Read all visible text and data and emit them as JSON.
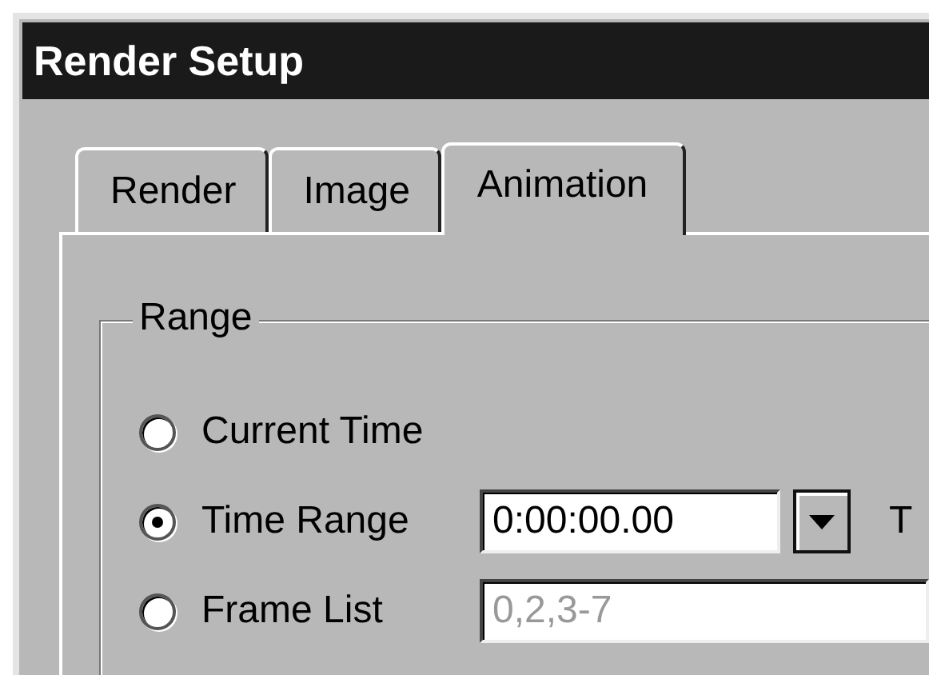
{
  "window": {
    "title": "Render Setup"
  },
  "tabs": [
    {
      "label": "Render",
      "selected": false
    },
    {
      "label": "Image",
      "selected": false
    },
    {
      "label": "Animation",
      "selected": true
    }
  ],
  "range_group": {
    "title": "Range",
    "options": [
      {
        "kind": "plain",
        "label": "Current Time",
        "selected": false
      },
      {
        "kind": "time",
        "label": "Time Range",
        "selected": true,
        "start_value": "0:00:00.00",
        "to_label": "T"
      },
      {
        "kind": "frames",
        "label": "Frame List",
        "selected": false,
        "value": "0,2,3-7",
        "disabled": true
      }
    ]
  }
}
